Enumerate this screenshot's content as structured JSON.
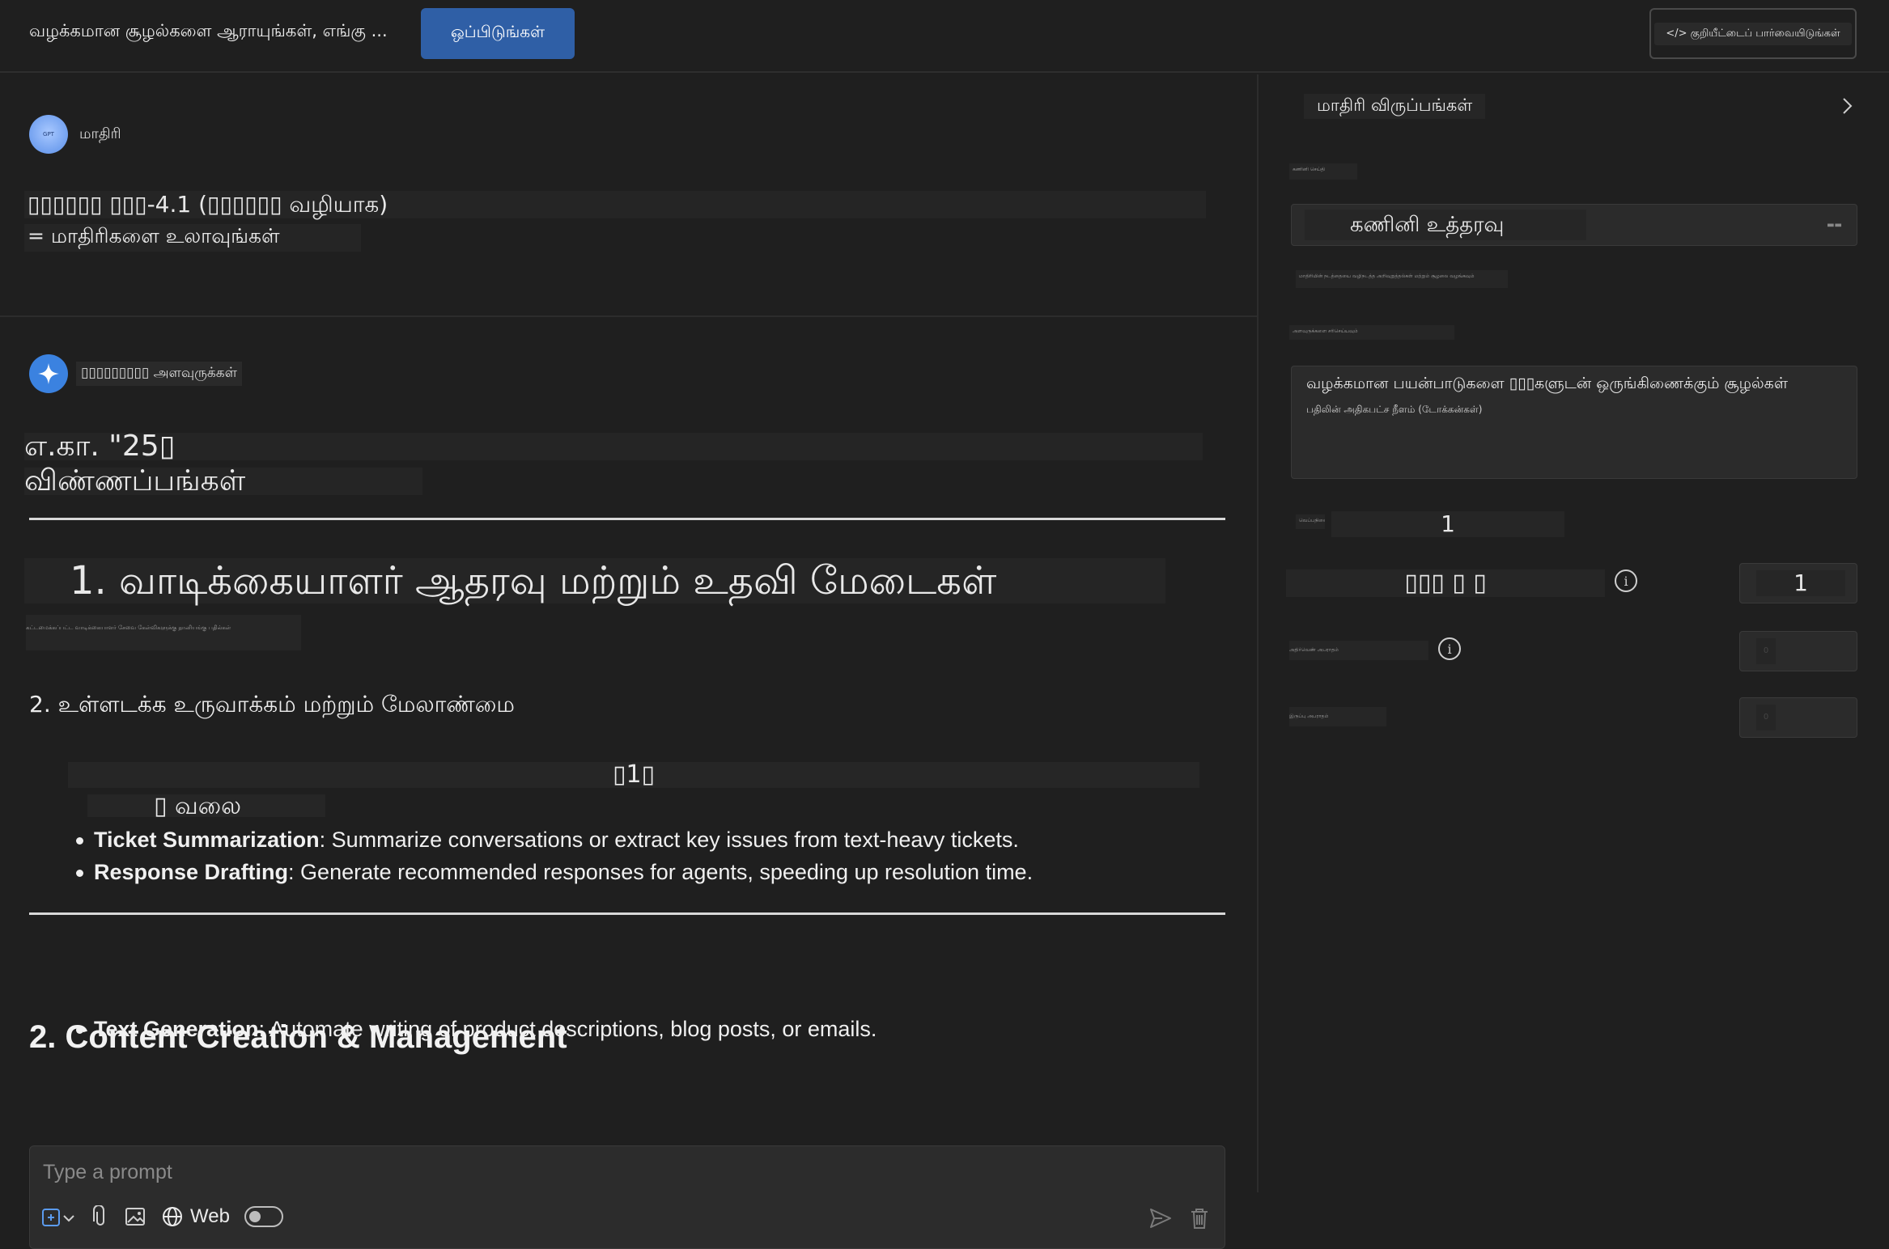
{
  "header": {
    "title": "வழக்கமான சூழல்களை ஆராயுங்கள், எங்கு ...",
    "compare_label": "ஒப்பிடுங்கள்",
    "code_label": "</> குறியீட்டைப் பார்வையிடுங்கள்"
  },
  "model_section": {
    "label": "மாதிரி",
    "avatar_text": "GPT",
    "name": "▯▯▯▯▯▯ ▯▯▯-4.1 (▯▯▯▯▯▯ வழியாக)",
    "browse_link": "= மாதிரிகளை உலாவுங்கள்"
  },
  "assistant": {
    "label": "▯▯▯▯▯▯▯▯▯ அளவுருக்கள்",
    "heading_line1": "எ.கா. \"25▯",
    "heading_line2": "விண்ணப்பங்கள்",
    "section1_heading": "1. வாடிக்கையாளர் ஆதரவு மற்றும் உதவி மேடைகள்",
    "tiny_text": "கட்டமைக்கப்பட்ட வாடிக்கையாளர் சேவை கேள்விகளுக்கு தானியங்கு பதில்கள்",
    "section2_tamil": "2. உள்ளடக்க உருவாக்கம் மற்றும் மேலாண்மை",
    "center_text": "▯1▯",
    "web_text": "▯ வலை",
    "bullets1": [
      {
        "bold": "Ticket Summarization",
        "text": ": Summarize conversations or extract key issues from text-heavy tickets."
      },
      {
        "bold": "Response Drafting",
        "text": ": Generate recommended responses for agents, speeding up resolution time."
      }
    ],
    "section2_heading": "2. Content Creation & Management",
    "bullets2": [
      {
        "bold": "Text Generation",
        "text": ": Automate writing of product descriptions, blog posts, or emails."
      }
    ]
  },
  "prompt": {
    "placeholder": "Type a prompt",
    "web_label": "Web"
  },
  "sidebar": {
    "title": "மாதிரி விருப்பங்கள்",
    "tiny_label_1": "கணினி செய்தி",
    "select_value": "கணினி உத்தரவு",
    "tiny_label_2": "மாதிரியின் நடத்தையை வழிநடத்த அறிவுறுத்தல்கள் மற்றும் சூழலை வழங்கவும்",
    "tiny_label_3": "அளவுருக்களை சரிசெய்யவும்",
    "textarea_line1": "வழக்கமான பயன்பாடுகளை ▯▯▯களுடன் ஒருங்கிணைக்கும் சூழல்கள்",
    "textarea_line2": "பதிலின் அதிகபட்ச நீளம் (டோக்கன்கள்)",
    "tiny_label_4": "வெப்பநிலை",
    "param_value_main": "1",
    "param1_label": "▯▯▯ ▯ ▯",
    "param1_value": "1",
    "param2_label": "அதிர்வெண் அபராதம்",
    "param2_value": "0",
    "param3_label": "இருப்பு அபராதம்",
    "param3_value": "0"
  },
  "colors": {
    "accent": "#2f5fa6",
    "background": "#1f1f1f",
    "panel": "#2b2b2b"
  }
}
